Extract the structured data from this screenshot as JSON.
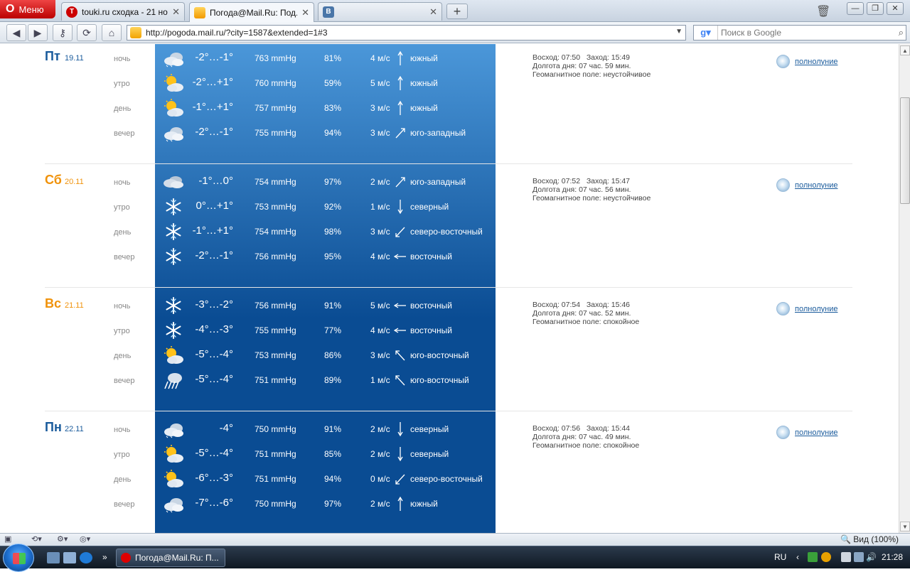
{
  "browser": {
    "menu_label": "Меню",
    "tabs": [
      {
        "label": "touki.ru сходка - 21 но...",
        "icon": "red-circle-icon"
      },
      {
        "label": "Погода@Mail.Ru: Под...",
        "icon": "weather-sun-icon"
      },
      {
        "label": "",
        "icon": "vk-icon"
      }
    ],
    "new_tab_label": "+",
    "address": "http://pogoda.mail.ru/?city=1587&extended=1#3",
    "search_placeholder": "Поиск в Google"
  },
  "labels": {
    "night": "ночь",
    "morning": "утро",
    "day": "день",
    "evening": "вечер",
    "moon_link": "полнолуние"
  },
  "days": [
    {
      "name": "Пт",
      "date": "19.11",
      "weekend": false,
      "sunrise": "Восход: 07:50",
      "sunset": "Заход: 15:49",
      "daylength": "Долгота дня: 07 час. 59 мин.",
      "geomag": "Геомагнитное поле: неустойчивое",
      "rows": [
        {
          "icon": "cloudy-night-icon",
          "temp": "-2°…-1°",
          "pressure": "763 mmHg",
          "humidity": "81%",
          "wind_speed": "4 м/с",
          "wind_dir": "южный",
          "arrow": "up"
        },
        {
          "icon": "sun-cloud-icon",
          "temp": "-2°…+1°",
          "pressure": "760 mmHg",
          "humidity": "59%",
          "wind_speed": "5 м/с",
          "wind_dir": "южный",
          "arrow": "up"
        },
        {
          "icon": "sun-cloud-icon",
          "temp": "-1°…+1°",
          "pressure": "757 mmHg",
          "humidity": "83%",
          "wind_speed": "3 м/с",
          "wind_dir": "южный",
          "arrow": "up"
        },
        {
          "icon": "cloudy-night-icon",
          "temp": "-2°…-1°",
          "pressure": "755 mmHg",
          "humidity": "94%",
          "wind_speed": "3 м/с",
          "wind_dir": "юго-западный",
          "arrow": "ne"
        }
      ]
    },
    {
      "name": "Сб",
      "date": "20.11",
      "weekend": true,
      "sunrise": "Восход: 07:52",
      "sunset": "Заход: 15:47",
      "daylength": "Долгота дня: 07 час. 56 мин.",
      "geomag": "Геомагнитное поле: неустойчивое",
      "rows": [
        {
          "icon": "overcast-icon",
          "temp": "-1°…0°",
          "pressure": "754 mmHg",
          "humidity": "97%",
          "wind_speed": "2 м/с",
          "wind_dir": "юго-западный",
          "arrow": "ne"
        },
        {
          "icon": "snowflake-icon",
          "temp": "0°…+1°",
          "pressure": "753 mmHg",
          "humidity": "92%",
          "wind_speed": "1 м/с",
          "wind_dir": "северный",
          "arrow": "down"
        },
        {
          "icon": "snowflake-icon",
          "temp": "-1°…+1°",
          "pressure": "754 mmHg",
          "humidity": "98%",
          "wind_speed": "3 м/с",
          "wind_dir": "северо-восточный",
          "arrow": "sw"
        },
        {
          "icon": "snowflake-icon",
          "temp": "-2°…-1°",
          "pressure": "756 mmHg",
          "humidity": "95%",
          "wind_speed": "4 м/с",
          "wind_dir": "восточный",
          "arrow": "left"
        }
      ]
    },
    {
      "name": "Вс",
      "date": "21.11",
      "weekend": true,
      "sunrise": "Восход: 07:54",
      "sunset": "Заход: 15:46",
      "daylength": "Долгота дня: 07 час. 52 мин.",
      "geomag": "Геомагнитное поле: спокойное",
      "rows": [
        {
          "icon": "snowflake-icon",
          "temp": "-3°…-2°",
          "pressure": "756 mmHg",
          "humidity": "91%",
          "wind_speed": "5 м/с",
          "wind_dir": "восточный",
          "arrow": "left"
        },
        {
          "icon": "snowflake-icon",
          "temp": "-4°…-3°",
          "pressure": "755 mmHg",
          "humidity": "77%",
          "wind_speed": "4 м/с",
          "wind_dir": "восточный",
          "arrow": "left"
        },
        {
          "icon": "sun-cloud-icon",
          "temp": "-5°…-4°",
          "pressure": "753 mmHg",
          "humidity": "86%",
          "wind_speed": "3 м/с",
          "wind_dir": "юго-восточный",
          "arrow": "nw"
        },
        {
          "icon": "snow-cloud-night-icon",
          "temp": "-5°…-4°",
          "pressure": "751 mmHg",
          "humidity": "89%",
          "wind_speed": "1 м/с",
          "wind_dir": "юго-восточный",
          "arrow": "nw"
        }
      ]
    },
    {
      "name": "Пн",
      "date": "22.11",
      "weekend": false,
      "sunrise": "Восход: 07:56",
      "sunset": "Заход: 15:44",
      "daylength": "Долгота дня: 07 час. 49 мин.",
      "geomag": "Геомагнитное поле: спокойное",
      "rows": [
        {
          "icon": "cloudy-night-icon",
          "temp": "-4°",
          "pressure": "750 mmHg",
          "humidity": "91%",
          "wind_speed": "2 м/с",
          "wind_dir": "северный",
          "arrow": "down"
        },
        {
          "icon": "sun-cloud-icon",
          "temp": "-5°…-4°",
          "pressure": "751 mmHg",
          "humidity": "85%",
          "wind_speed": "2 м/с",
          "wind_dir": "северный",
          "arrow": "down"
        },
        {
          "icon": "sun-cloud-icon",
          "temp": "-6°…-3°",
          "pressure": "751 mmHg",
          "humidity": "94%",
          "wind_speed": "0 м/с",
          "wind_dir": "северо-восточный",
          "arrow": "sw"
        },
        {
          "icon": "cloudy-night-icon",
          "temp": "-7°…-6°",
          "pressure": "750 mmHg",
          "humidity": "97%",
          "wind_speed": "2 м/с",
          "wind_dir": "южный",
          "arrow": "up"
        }
      ]
    }
  ],
  "statusbar": {
    "zoom": "Вид (100%)"
  },
  "taskbar": {
    "task_label": "Погода@Mail.Ru: П...",
    "lang": "RU",
    "clock": "21:28"
  },
  "colors": {
    "blue_top": "#4b97d9",
    "blue_bottom": "#0a4c93",
    "weekday": "#1a5b9c",
    "weekend": "#f0920a"
  }
}
